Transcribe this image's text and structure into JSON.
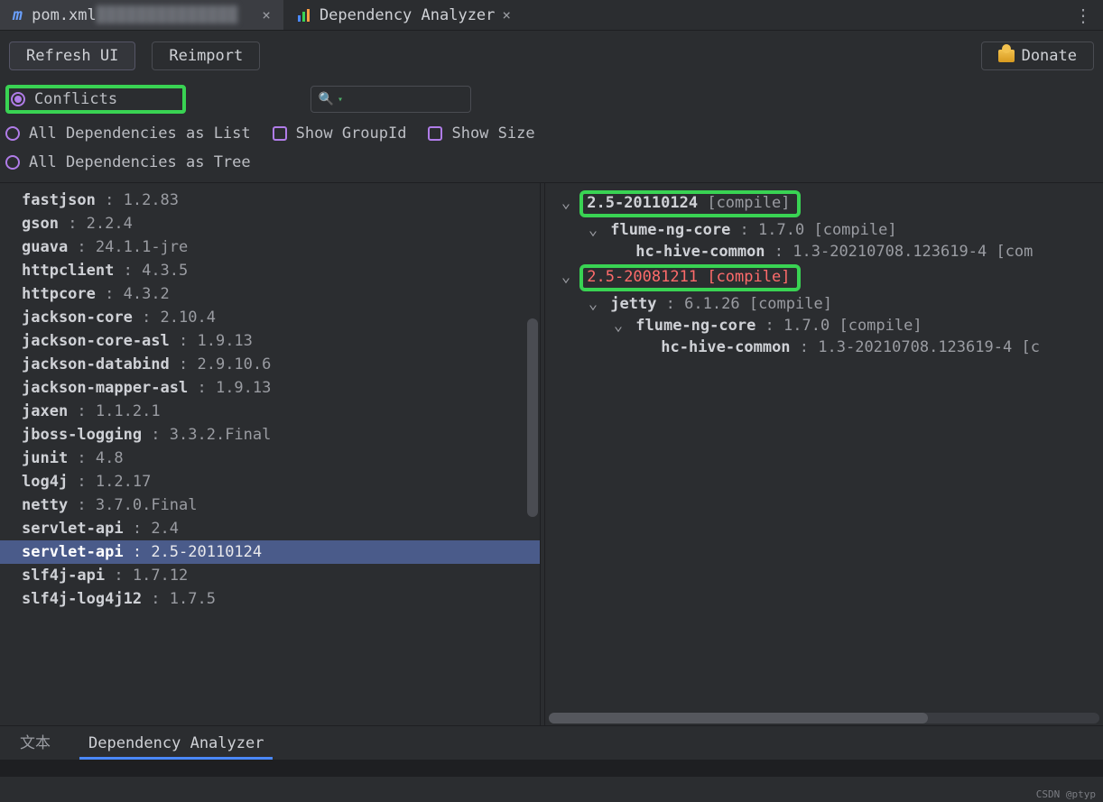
{
  "tabs": {
    "pom": {
      "icon_label": "m",
      "label": "pom.xml",
      "obscured": "██████████████"
    },
    "analyzer": {
      "label": "Dependency Analyzer"
    }
  },
  "toolbar": {
    "refresh": "Refresh UI",
    "reimport": "Reimport",
    "donate": "Donate"
  },
  "filters": {
    "conflicts": "Conflicts",
    "all_list": "All Dependencies as List",
    "all_tree": "All Dependencies as Tree",
    "show_groupid": "Show GroupId",
    "show_size": "Show Size",
    "search_placeholder": ""
  },
  "dependencies": [
    {
      "name": "fastjson",
      "version": "1.2.83"
    },
    {
      "name": "gson",
      "version": "2.2.4"
    },
    {
      "name": "guava",
      "version": "24.1.1-jre"
    },
    {
      "name": "httpclient",
      "version": "4.3.5"
    },
    {
      "name": "httpcore",
      "version": "4.3.2"
    },
    {
      "name": "jackson-core",
      "version": "2.10.4"
    },
    {
      "name": "jackson-core-asl",
      "version": "1.9.13"
    },
    {
      "name": "jackson-databind",
      "version": "2.9.10.6"
    },
    {
      "name": "jackson-mapper-asl",
      "version": "1.9.13"
    },
    {
      "name": "jaxen",
      "version": "1.1.2.1"
    },
    {
      "name": "jboss-logging",
      "version": "3.3.2.Final"
    },
    {
      "name": "junit",
      "version": "4.8"
    },
    {
      "name": "log4j",
      "version": "1.2.17"
    },
    {
      "name": "netty",
      "version": "3.7.0.Final"
    },
    {
      "name": "servlet-api",
      "version": "2.4"
    },
    {
      "name": "servlet-api",
      "version": "2.5-20110124",
      "selected": true
    },
    {
      "name": "slf4j-api",
      "version": "1.7.12"
    },
    {
      "name": "slf4j-log4j12",
      "version": "1.7.5"
    }
  ],
  "tree": {
    "v1": {
      "version": "2.5-20110124",
      "scope": "[compile]"
    },
    "v1_c1": {
      "name": "flume-ng-core",
      "version": "1.7.0",
      "scope": "[compile]"
    },
    "v1_c1_c1": {
      "name": "hc-hive-common",
      "version": "1.3-20210708.123619-4",
      "scope": "[com"
    },
    "v2": {
      "version": "2.5-20081211",
      "scope": "[compile]"
    },
    "v2_c1": {
      "name": "jetty",
      "version": "6.1.26",
      "scope": "[compile]"
    },
    "v2_c1_c1": {
      "name": "flume-ng-core",
      "version": "1.7.0",
      "scope": "[compile]"
    },
    "v2_c1_c1_c1": {
      "name": "hc-hive-common",
      "version": "1.3-20210708.123619-4",
      "scope": "[c"
    }
  },
  "bottom_tabs": {
    "text": "文本",
    "analyzer": "Dependency Analyzer"
  },
  "watermark": "CSDN @ptyp",
  "sep": " : "
}
